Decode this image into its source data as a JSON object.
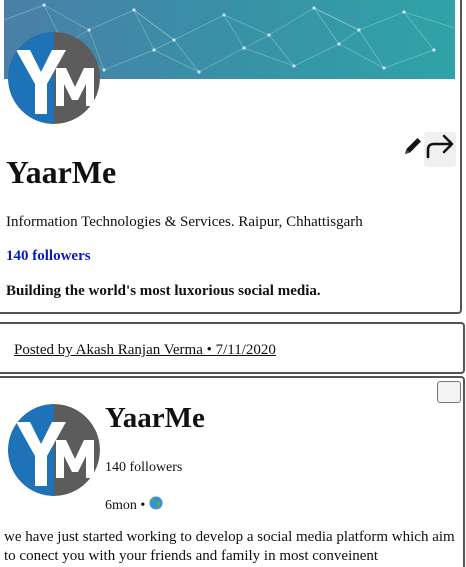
{
  "company": {
    "name": "YaarMe",
    "industry": "Information Technologies & Services. Raipur, Chhattisgarh",
    "followers": "140 followers",
    "tagline": "Building the world's most luxorious social media.",
    "logo_letters": "YM"
  },
  "actions": {
    "edit_icon": "pencil-icon",
    "share_icon": "share-arrow-icon"
  },
  "posted_by": "Posted by Akash Ranjan Verma • 7/11/2020",
  "post": {
    "company_name": "YaarMe",
    "followers": "140 followers",
    "age": "6mon •",
    "visibility_icon": "globe-icon",
    "text": "we have just started working to develop a social media platform which aim to conect you with your friends and family in most conveinent"
  },
  "colors": {
    "cover_gradient_start": "#4a7fa8",
    "cover_gradient_end": "#2fa3a7",
    "logo_blue": "#1e73b8",
    "logo_gray": "#5c5c5c",
    "link_blue": "#0d1bb8"
  }
}
